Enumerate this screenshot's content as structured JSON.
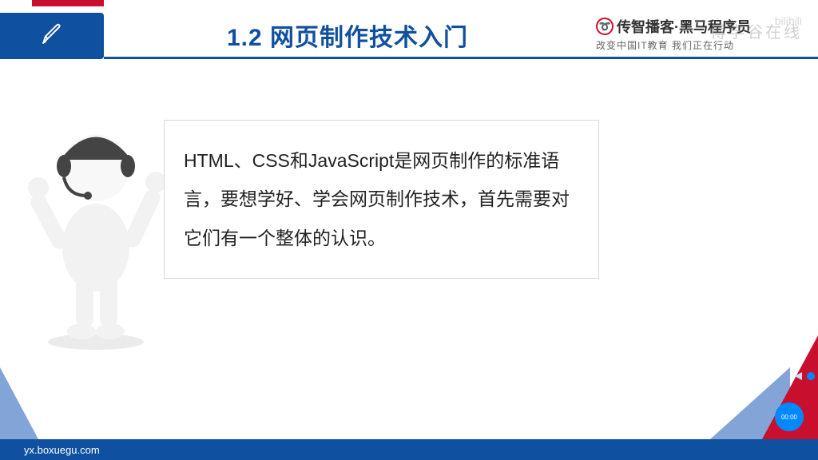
{
  "header": {
    "section_title": "1.2 网页制作技术入门"
  },
  "brand": {
    "name": "传智播客·黑马程序员",
    "tagline": "改变中国IT教育 我们正在行动"
  },
  "watermark": {
    "top_right": "博学谷在线",
    "bili_logo": "bilibili"
  },
  "content": {
    "paragraph": "HTML、CSS和JavaScript是网页制作的标准语言，要想学好、学会网页制作技术，首先需要对它们有一个整体的认识。"
  },
  "footer": {
    "url": "yx.boxuegu.com"
  },
  "play_indicator": {
    "label": "00:00"
  }
}
